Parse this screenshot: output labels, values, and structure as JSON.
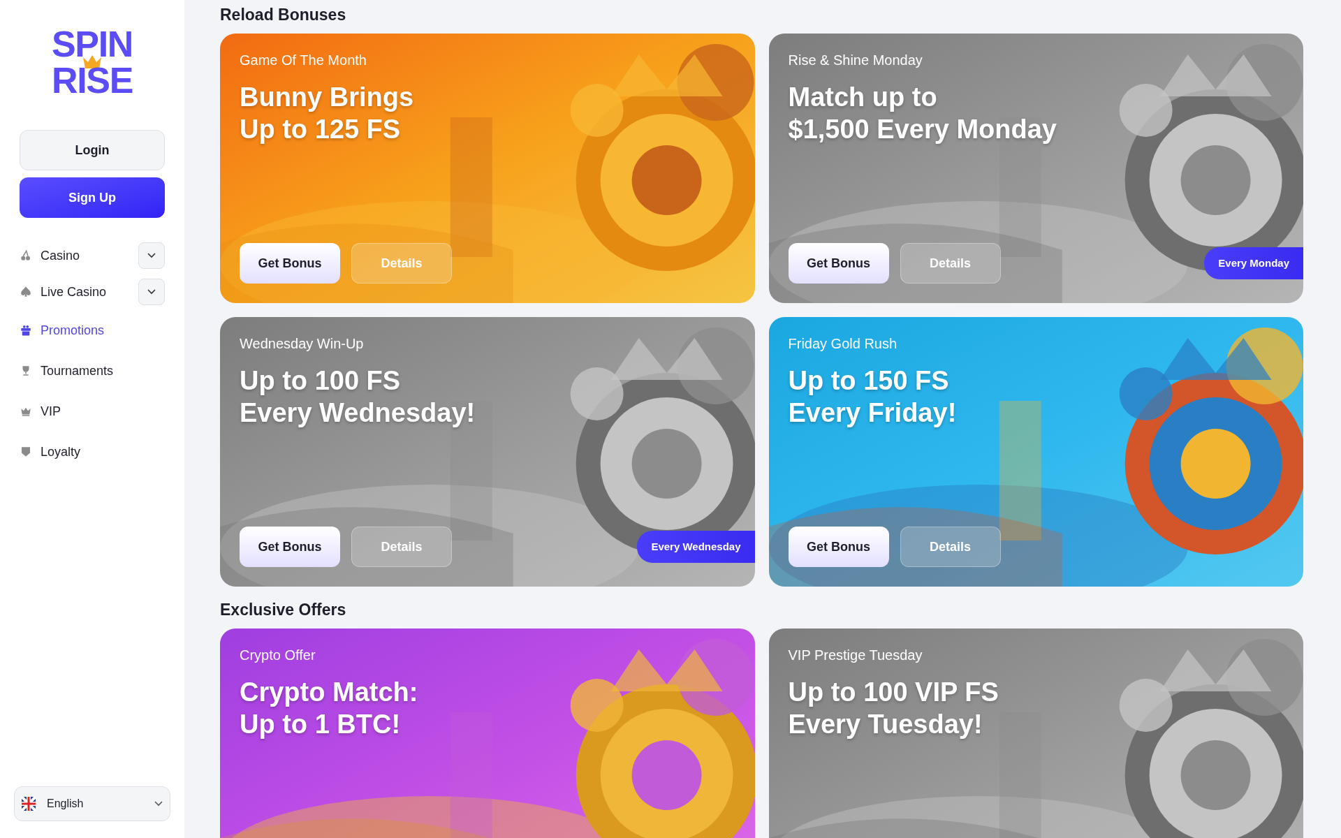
{
  "logo": {
    "line_1": "SPIN",
    "line_2": "RISE"
  },
  "auth": {
    "login": "Login",
    "signup": "Sign Up"
  },
  "nav": [
    {
      "label": "Casino",
      "selected": false,
      "expandable": true
    },
    {
      "label": "Live Casino",
      "selected": false,
      "expandable": true
    },
    {
      "label": "Promotions",
      "selected": true,
      "expandable": false
    },
    {
      "label": "Tournaments",
      "selected": false,
      "expandable": false
    },
    {
      "label": "VIP",
      "selected": false,
      "expandable": false
    },
    {
      "label": "Loyalty",
      "selected": false,
      "expandable": false
    }
  ],
  "language": {
    "label": "English"
  },
  "sections": [
    {
      "title": "Reload Bonuses",
      "cards": [
        {
          "kind": "orange",
          "subtitle": "Game Of The Month",
          "title": "Bunny Brings\nUp to 125 FS",
          "primary": "Get Bonus",
          "secondary": "Details"
        },
        {
          "kind": "gray",
          "subtitle": "Rise & Shine Monday",
          "title": "Match up to\n$1,500 Every Monday",
          "primary": "Get Bonus",
          "secondary": "Details",
          "badge": "Every Monday"
        },
        {
          "kind": "gray",
          "subtitle": "Wednesday Win-Up",
          "title": "Up to 100 FS\nEvery Wednesday!",
          "primary": "Get Bonus",
          "secondary": "Details",
          "badge": "Every Wednesday"
        },
        {
          "kind": "blue",
          "subtitle": "Friday Gold Rush",
          "title": "Up to 150 FS\nEvery Friday!",
          "primary": "Get Bonus",
          "secondary": "Details"
        }
      ]
    },
    {
      "title": "Exclusive Offers",
      "cards": [
        {
          "kind": "purple",
          "subtitle": "Crypto Offer",
          "title": "Crypto Match:\nUp to 1 BTC!"
        },
        {
          "kind": "gray",
          "subtitle": "VIP Prestige Tuesday",
          "title": "Up to 100 VIP FS\nEvery Tuesday!"
        }
      ]
    }
  ]
}
